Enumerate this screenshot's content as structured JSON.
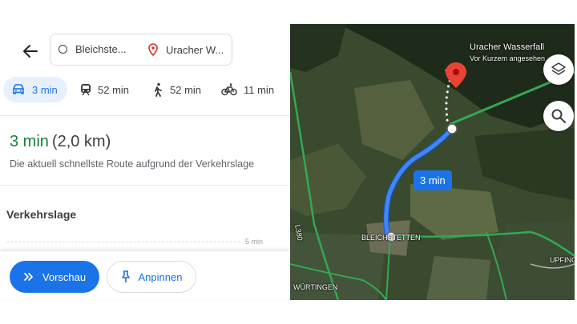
{
  "header": {
    "from": "Bleichste...",
    "to": "Uracher W..."
  },
  "modes": [
    {
      "icon": "car-icon",
      "label": "3 min",
      "active": true
    },
    {
      "icon": "train-icon",
      "label": "52 min"
    },
    {
      "icon": "walk-icon",
      "label": "52 min"
    },
    {
      "icon": "bike-icon",
      "label": "11 min"
    }
  ],
  "route": {
    "time": "3 min",
    "distance": "(2,0 km)",
    "description": "Die aktuell schnellste Route aufgrund der Verkehrslage"
  },
  "traffic": {
    "heading": "Verkehrslage",
    "scale_label": "5 min"
  },
  "actions": {
    "preview_label": "Vorschau",
    "pin_label": "Anpinnen"
  },
  "map": {
    "destination_name": "Uracher Wasserfall",
    "destination_sub": "Vor Kurzem angesehen",
    "route_label": "3 min",
    "place_bleichstetten": "BLEICHSTETTEN",
    "place_wuertingen": "WÜRTINGEN",
    "place_upfingen": "UPFING",
    "road_label": "L380",
    "route_color": "#1a73e8"
  }
}
